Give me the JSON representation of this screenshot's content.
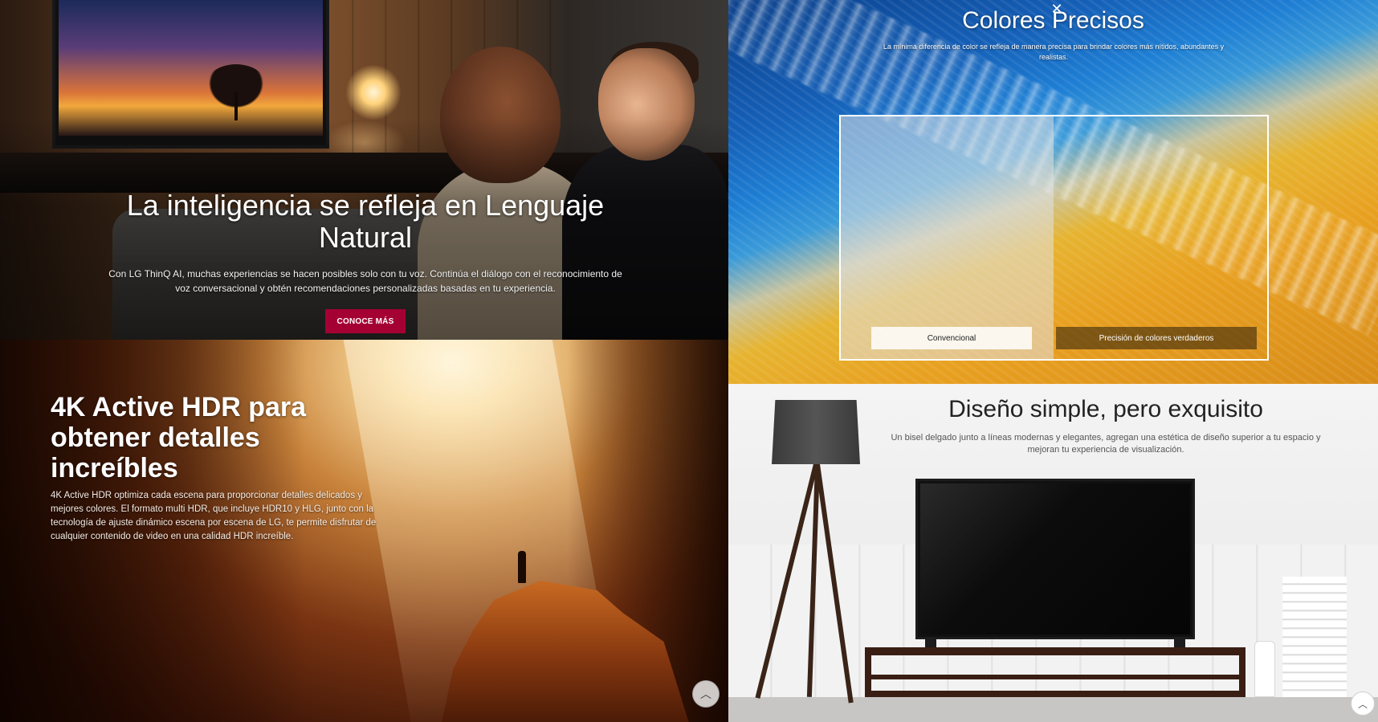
{
  "panels": {
    "thinq": {
      "title": "La inteligencia se refleja en Lenguaje Natural",
      "description": "Con LG ThinQ AI, muchas experiencias se hacen posibles solo con tu voz. Continúa el diálogo con el reconocimiento de voz conversacional y obtén recomendaciones personalizadas basadas en tu experiencia.",
      "cta_label": "CONOCE MÁS",
      "cta_color": "#a50034"
    },
    "colores": {
      "title": "Colores Precisos",
      "description": "La mínima diferencia de color se refleja de manera precisa para brindar colores más nítidos, abundantes y realistas.",
      "compare_left_label": "Convencional",
      "compare_right_label": "Precisión de colores verdaderos",
      "close_icon": "close-icon"
    },
    "hdr": {
      "title": "4K Active HDR para obtener detalles increíbles",
      "description": "4K Active HDR optimiza cada escena para proporcionar detalles delicados y mejores colores. El formato multi HDR, que incluye HDR10 y HLG, junto con la tecnología de ajuste dinámico escena por escena de LG, te permite disfrutar de cualquier contenido de video en una calidad HDR increíble.",
      "scroll_icon": "chevron-up-icon"
    },
    "diseno": {
      "title": "Diseño simple, pero exquisito",
      "description": "Un bisel delgado junto a líneas modernas y elegantes, agregan una estética de diseño superior a tu espacio y mejoran tu experiencia de visualización.",
      "scroll_icon": "chevron-up-icon"
    }
  },
  "icons": {
    "close_glyph": "✕",
    "chevron_up_glyph": "︿"
  }
}
